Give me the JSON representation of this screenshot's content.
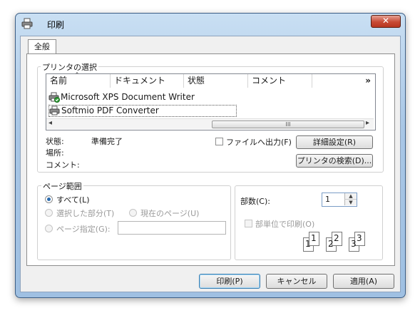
{
  "window": {
    "title": "印刷",
    "close_glyph": "✕"
  },
  "tabs": [
    {
      "label": "全般"
    }
  ],
  "printer_group": {
    "label": "プリンタの選択",
    "columns": [
      "名前",
      "ドキュメント",
      "状態",
      "コメント"
    ],
    "more_columns_glyph": "»",
    "sort_indicator": "ˆ",
    "printers": [
      {
        "name": "Microsoft XPS Document Writer",
        "icon": "printer-default-icon"
      },
      {
        "name": "Softmio PDF Converter",
        "icon": "printer-icon"
      }
    ],
    "scroll_left": "◂",
    "scroll_right": "▸",
    "scroll_grip": "III"
  },
  "status": {
    "state_label": "状態:",
    "state_value": "準備完了",
    "location_label": "場所:",
    "comment_label": "コメント:",
    "print_to_file_label": "ファイルへ出力(F)",
    "print_to_file_checked": false,
    "preferences_button": "詳細設定(R)",
    "find_printer_button": "プリンタの検索(D)..."
  },
  "page_range": {
    "label": "ページ範囲",
    "all": "すべて(L)",
    "selection": "選択した部分(T)",
    "current_page": "現在のページ(U)",
    "pages": "ページ指定(G):",
    "pages_value": "",
    "selected": "all"
  },
  "copies": {
    "label": "部数(C):",
    "value": "1",
    "collate_label": "部単位で印刷(O)",
    "collate_checked": false,
    "collate_digits": [
      "1",
      "1",
      "2",
      "2",
      "3",
      "3"
    ]
  },
  "buttons": {
    "print": "印刷(P)",
    "cancel": "キャンセル",
    "apply": "適用(A)"
  }
}
